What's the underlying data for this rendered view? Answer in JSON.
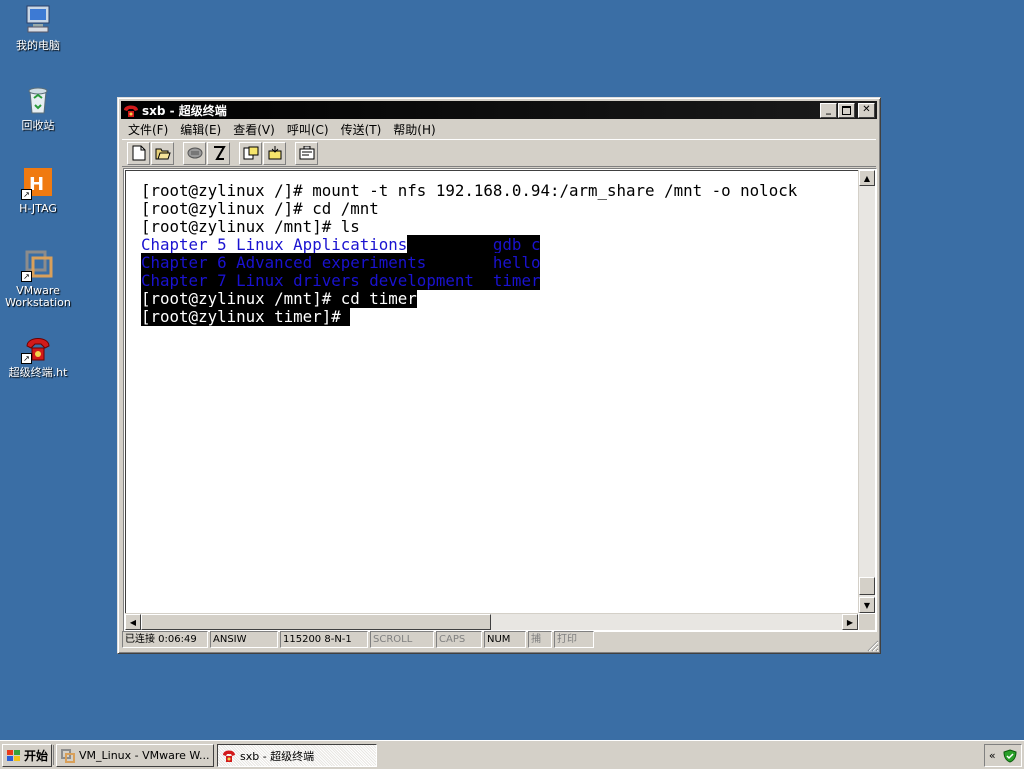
{
  "desktop": {
    "icons": [
      {
        "label": "我的电脑",
        "icon": "my-computer-icon"
      },
      {
        "label": "回收站",
        "icon": "recycle-bin-icon"
      },
      {
        "label": "H-JTAG",
        "icon": "hjtag-icon"
      },
      {
        "label": "VMware Workstation",
        "icon": "vmware-icon"
      },
      {
        "label": "超级终端.ht",
        "icon": "hyperterminal-shortcut-icon"
      }
    ]
  },
  "window": {
    "title": "sxb - 超级终端",
    "menu": [
      "文件(F)",
      "编辑(E)",
      "查看(V)",
      "呼叫(C)",
      "传送(T)",
      "帮助(H)"
    ],
    "toolbar": [
      "new-icon",
      "open-icon",
      "disconnect-icon",
      "dial-icon",
      "send-icon",
      "receive-icon",
      "properties-icon"
    ],
    "terminal": {
      "lines": [
        "[root@zylinux /]# mount -t nfs 192.168.0.94:/arm_share /mnt -o nolock",
        "[root@zylinux /]# cd /mnt",
        "[root@zylinux /mnt]# ls"
      ],
      "ls_rows": [
        {
          "dir": "Chapter_5_Linux_Applications",
          "gap": "         ",
          "file": "gdb_c"
        },
        {
          "dir": "Chapter_6_Advanced_experiments",
          "gap": "       ",
          "file": "hello"
        },
        {
          "dir": "Chapter_7_Linux_drivers_development",
          "gap": "  ",
          "file": "timer"
        }
      ],
      "cmd_cd_timer": "[root@zylinux /mnt]# cd timer",
      "prompt": "[root@zylinux timer]# "
    },
    "status": {
      "connected": "已连接 0:06:49",
      "emulation": "ANSIW",
      "settings": "115200 8-N-1",
      "scroll": "SCROLL",
      "caps": "CAPS",
      "num": "NUM",
      "capture": "捕",
      "print": "打印"
    }
  },
  "taskbar": {
    "start": "开始",
    "tasks": [
      "VM_Linux - VMware W...",
      "sxb - 超级终端"
    ],
    "tray_expand": "«"
  },
  "colors": {
    "desktop": "#3a6ea5",
    "terminal_blue": "#1a12d0"
  }
}
